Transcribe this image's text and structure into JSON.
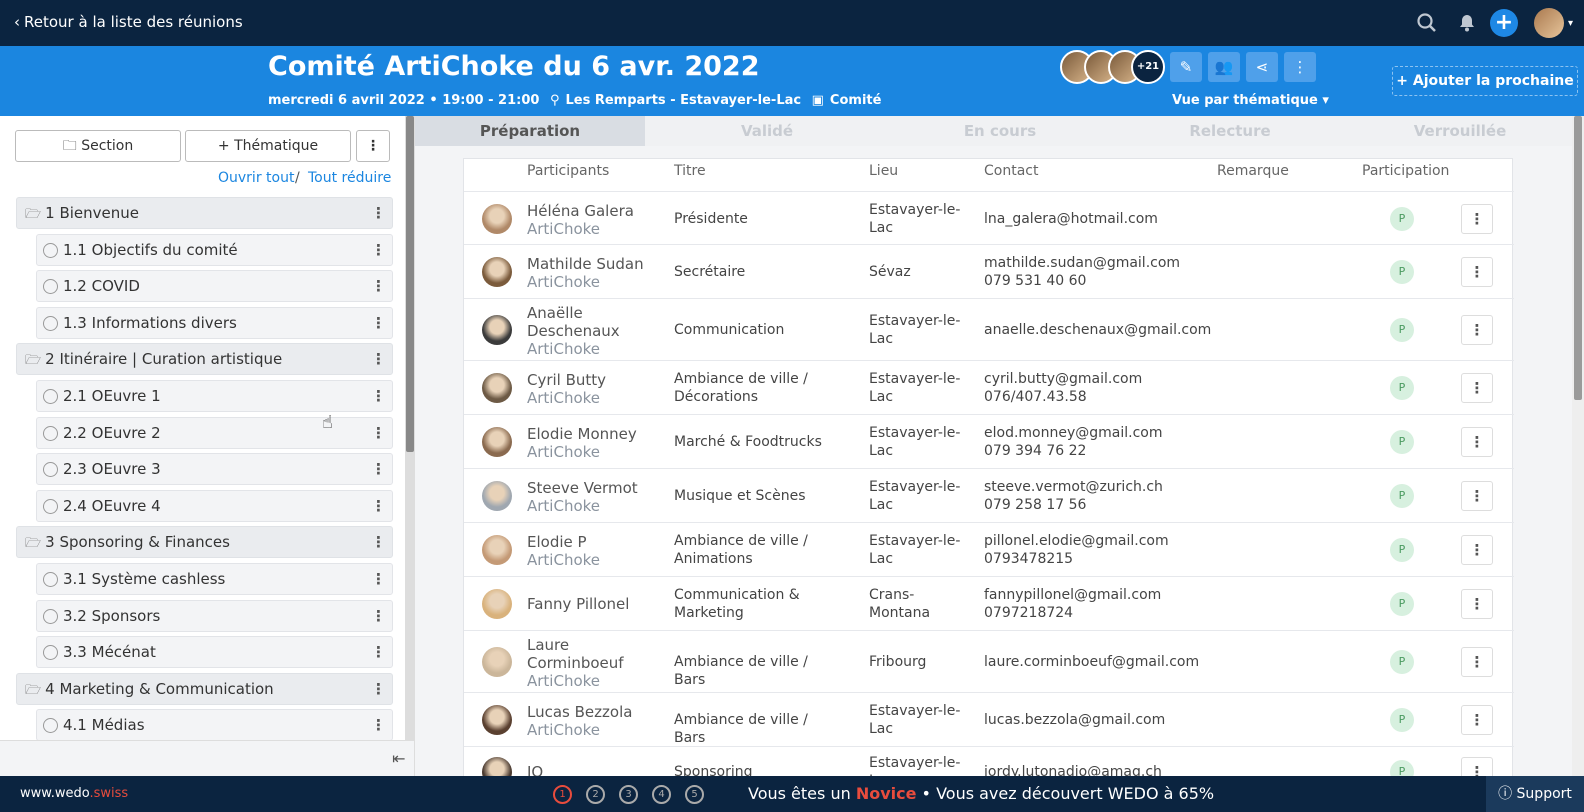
{
  "topbar": {
    "back_label": "Retour à la liste des réunions"
  },
  "meeting": {
    "title": "Comité ArtiChoke du 6 avr. 2022",
    "date_time": "mercredi 6 avril 2022 • 19:00 - 21:00",
    "location": "Les Remparts - Estavayer-le-Lac",
    "type": "Comité",
    "extra_participants": "+21",
    "view_mode": "Vue par thématique",
    "add_next_label": "+ Ajouter la prochaine"
  },
  "sidebar": {
    "section_btn": "Section",
    "topic_btn": "+ Thématique",
    "open_all": "Ouvrir tout",
    "slash": "/",
    "reduce_all": "Tout réduire",
    "sections": [
      {
        "num": "1",
        "label": "Bienvenue",
        "items": [
          {
            "num": "1.1",
            "label": "Objectifs du comité"
          },
          {
            "num": "1.2",
            "label": "COVID"
          },
          {
            "num": "1.3",
            "label": "Informations divers"
          }
        ]
      },
      {
        "num": "2",
        "label": "Itinéraire | Curation artistique",
        "items": [
          {
            "num": "2.1",
            "label": "OEuvre 1"
          },
          {
            "num": "2.2",
            "label": "OEuvre 2"
          },
          {
            "num": "2.3",
            "label": "OEuvre 3"
          },
          {
            "num": "2.4",
            "label": "OEuvre 4"
          }
        ]
      },
      {
        "num": "3",
        "label": "Sponsoring & Finances",
        "items": [
          {
            "num": "3.1",
            "label": "Système cashless"
          },
          {
            "num": "3.2",
            "label": "Sponsors"
          },
          {
            "num": "3.3",
            "label": "Mécénat"
          }
        ]
      },
      {
        "num": "4",
        "label": "Marketing & Communication",
        "items": [
          {
            "num": "4.1",
            "label": "Médias"
          }
        ]
      }
    ]
  },
  "steps": [
    "Préparation",
    "Validé",
    "En cours",
    "Relecture",
    "Verrouillée"
  ],
  "table": {
    "headers": [
      "Participants",
      "Titre",
      "Lieu",
      "Contact",
      "Remarque",
      "Participation"
    ],
    "rows": [
      {
        "name": "Héléna Galera",
        "org": "ArtiChoke",
        "title": "Présidente",
        "place": "Estavayer-le-Lac",
        "contact": "lna_galera@hotmail.com",
        "phone": "",
        "badge": "P"
      },
      {
        "name": "Mathilde Sudan",
        "org": "ArtiChoke",
        "title": "Secrétaire",
        "place": "Sévaz",
        "contact": "mathilde.sudan@gmail.com",
        "phone": "079 531 40 60",
        "badge": "P"
      },
      {
        "name": "Anaëlle Deschenaux",
        "org": "ArtiChoke",
        "title": "Communication",
        "place": "Estavayer-le-Lac",
        "contact": "anaelle.deschenaux@gmail.com",
        "phone": "",
        "badge": "P"
      },
      {
        "name": "Cyril Butty",
        "org": "ArtiChoke",
        "title": "Ambiance de ville / Décorations",
        "place": "Estavayer-le-Lac",
        "contact": "cyril.butty@gmail.com",
        "phone": "076/407.43.58",
        "badge": "P"
      },
      {
        "name": "Elodie Monney",
        "org": "ArtiChoke",
        "title": "Marché & Foodtrucks",
        "place": "Estavayer-le-Lac",
        "contact": "elod.monney@gmail.com",
        "phone": "079 394 76 22",
        "badge": "P"
      },
      {
        "name": "Steeve Vermot",
        "org": "ArtiChoke",
        "title": "Musique et Scènes",
        "place": "Estavayer-le-Lac",
        "contact": "steeve.vermot@zurich.ch",
        "phone": "079 258 17 56",
        "badge": "P"
      },
      {
        "name": "Elodie P",
        "org": "ArtiChoke",
        "title": "Ambiance de ville / Animations",
        "place": "Estavayer-le-Lac",
        "contact": "pillonel.elodie@gmail.com",
        "phone": "0793478215",
        "badge": "P"
      },
      {
        "name": "Fanny Pillonel",
        "org": "",
        "title": "Communication & Marketing",
        "place": "Crans-Montana",
        "contact": "fannypillonel@gmail.com",
        "phone": "0797218724",
        "badge": "P"
      },
      {
        "name": "Laure Corminboeuf",
        "org": "ArtiChoke",
        "title": "Ambiance de ville / Bars",
        "place": "Fribourg",
        "contact": "laure.corminboeuf@gmail.com",
        "phone": "",
        "badge": "P"
      },
      {
        "name": "Lucas Bezzola",
        "org": "ArtiChoke",
        "title": "Ambiance de ville / Bars",
        "place": "Estavayer-le-Lac",
        "contact": "lucas.bezzola@gmail.com",
        "phone": "",
        "badge": "P"
      },
      {
        "name": "JO",
        "org": "",
        "title": "Sponsoring",
        "place": "Estavayer-le-Lac",
        "contact": "jordy.lutonadio@amag.ch",
        "phone": "",
        "badge": "P"
      }
    ]
  },
  "footer": {
    "site": "www.wedo",
    "tld": ".swiss",
    "levels": [
      "1",
      "2",
      "3",
      "4",
      "5"
    ],
    "msg_pre": "Vous êtes un",
    "msg_level": "Novice",
    "msg_post": "• Vous avez découvert WEDO à 65%",
    "support": "Support"
  },
  "colors": {
    "brand": "#1b86e0",
    "navy": "#0b2440",
    "accent": "#e84c3d"
  }
}
